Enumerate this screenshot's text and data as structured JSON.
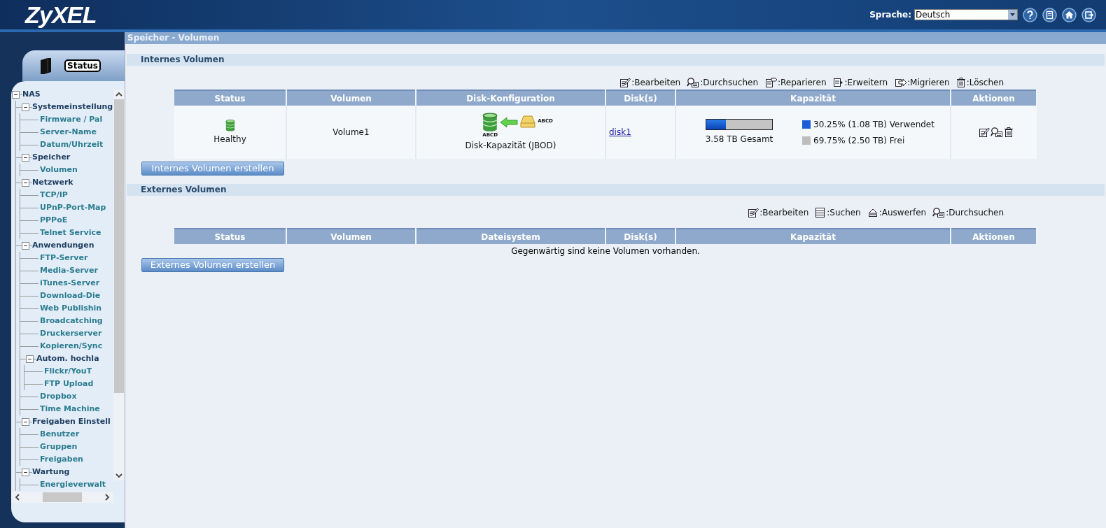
{
  "header": {
    "logo": "ZyXEL",
    "language_label": "Sprache:",
    "language": {
      "value": "Deutsch"
    }
  },
  "sidebar": {
    "tab": "Status",
    "tree": [
      {
        "kind": "group",
        "label": "NAS",
        "expanded": true,
        "children": [
          {
            "kind": "group",
            "label": "Systemeinstellung",
            "expanded": true,
            "children": [
              {
                "kind": "leaf",
                "label": "Firmware / Pal"
              },
              {
                "kind": "leaf",
                "label": "Server-Name"
              },
              {
                "kind": "leaf",
                "label": "Datum/Uhrzeit"
              }
            ]
          },
          {
            "kind": "group",
            "label": "Speicher",
            "expanded": true,
            "children": [
              {
                "kind": "leaf",
                "label": "Volumen"
              }
            ]
          },
          {
            "kind": "group",
            "label": "Netzwerk",
            "expanded": true,
            "children": [
              {
                "kind": "leaf",
                "label": "TCP/IP"
              },
              {
                "kind": "leaf",
                "label": "UPnP-Port-Map"
              },
              {
                "kind": "leaf",
                "label": "PPPoE"
              },
              {
                "kind": "leaf",
                "label": "Telnet Service"
              }
            ]
          },
          {
            "kind": "group",
            "label": "Anwendungen",
            "expanded": true,
            "children": [
              {
                "kind": "leaf",
                "label": "FTP-Server"
              },
              {
                "kind": "leaf",
                "label": "Media-Server"
              },
              {
                "kind": "leaf",
                "label": "iTunes-Server"
              },
              {
                "kind": "leaf",
                "label": "Download-Die"
              },
              {
                "kind": "leaf",
                "label": "Web Publishin"
              },
              {
                "kind": "leaf",
                "label": "Broadcatching"
              },
              {
                "kind": "leaf",
                "label": "Druckerserver"
              },
              {
                "kind": "leaf",
                "label": "Kopieren/Sync"
              },
              {
                "kind": "group",
                "label": "Autom. hochla",
                "expanded": true,
                "children": [
                  {
                    "kind": "leaf",
                    "label": "Flickr/YouT"
                  },
                  {
                    "kind": "leaf",
                    "label": "FTP Upload"
                  }
                ]
              },
              {
                "kind": "leaf",
                "label": "Dropbox"
              },
              {
                "kind": "leaf",
                "label": "Time Machine"
              }
            ]
          },
          {
            "kind": "group",
            "label": "Freigaben Einstell",
            "expanded": true,
            "children": [
              {
                "kind": "leaf",
                "label": "Benutzer"
              },
              {
                "kind": "leaf",
                "label": "Gruppen"
              },
              {
                "kind": "leaf",
                "label": "Freigaben"
              }
            ]
          },
          {
            "kind": "group",
            "label": "Wartung",
            "expanded": true,
            "children": [
              {
                "kind": "leaf",
                "label": "Energieverwalt"
              }
            ]
          }
        ]
      }
    ]
  },
  "page_title": "Speicher - Volumen",
  "internal": {
    "title": "Internes Volumen",
    "legend": [
      ":Bearbeiten",
      ":Durchsuchen",
      ":Reparieren",
      ":Erweitern",
      ":Migrieren",
      ":Löschen"
    ],
    "columns": [
      "Status",
      "Volumen",
      "Disk-Konfiguration",
      "Disk(s)",
      "Kapazität",
      "Aktionen"
    ],
    "rows": [
      {
        "status": "Healthy",
        "volume": "Volume1",
        "disk_config": {
          "label": "Disk-Kapazität (JBOD)",
          "target_tag": "ABCD",
          "source_tag": "ABCD"
        },
        "disks": "disk1",
        "capacity": {
          "level": 0.3025,
          "total": "3.58 TB Gesamt",
          "legend": [
            {
              "label": "30.25% (1.08 TB) Verwendet",
              "color": "#1a5fd6"
            },
            {
              "label": "69.75% (2.50 TB) Frei",
              "color": "#bdbdbd"
            }
          ]
        }
      }
    ],
    "create_button": "Internes Volumen erstellen"
  },
  "external": {
    "title": "Externes Volumen",
    "legend": [
      ":Bearbeiten",
      ":Suchen",
      ":Auswerfen",
      ":Durchsuchen"
    ],
    "columns": [
      "Status",
      "Volumen",
      "Dateisystem",
      "Disk(s)",
      "Kapazität",
      "Aktionen"
    ],
    "empty_message": "Gegenwärtig sind keine Volumen vorhanden.",
    "create_button": "Externes Volumen erstellen"
  }
}
